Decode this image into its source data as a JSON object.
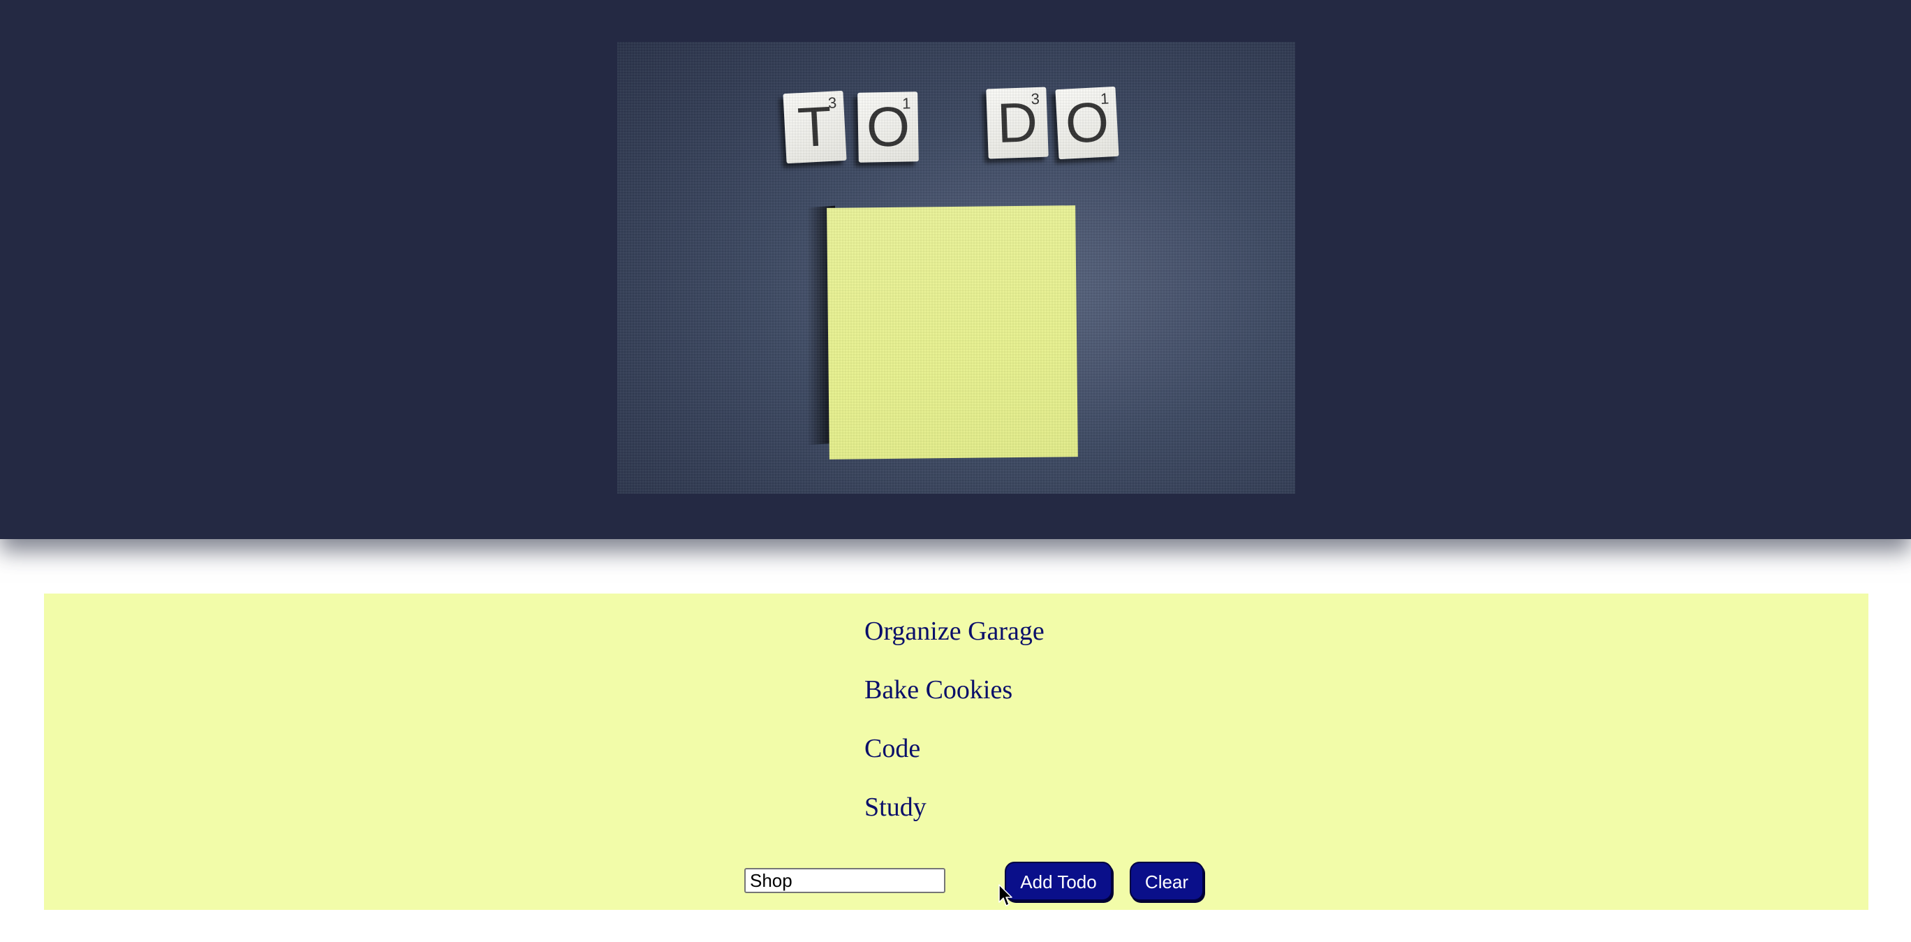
{
  "hero": {
    "tiles": [
      {
        "letter": "T",
        "score": "3"
      },
      {
        "letter": "O",
        "score": "1"
      },
      {
        "letter": "D",
        "score": "3"
      },
      {
        "letter": "O",
        "score": "1"
      }
    ]
  },
  "todos": [
    "Organize Garage",
    "Bake Cookies",
    "Code",
    "Study"
  ],
  "form": {
    "input_value": "Shop",
    "add_label": "Add Todo",
    "clear_label": "Clear"
  },
  "colors": {
    "header_bg": "#242943",
    "panel_bg": "#f2fca9",
    "todo_text": "#0a0f6a",
    "button_bg": "#0a0f8a"
  }
}
